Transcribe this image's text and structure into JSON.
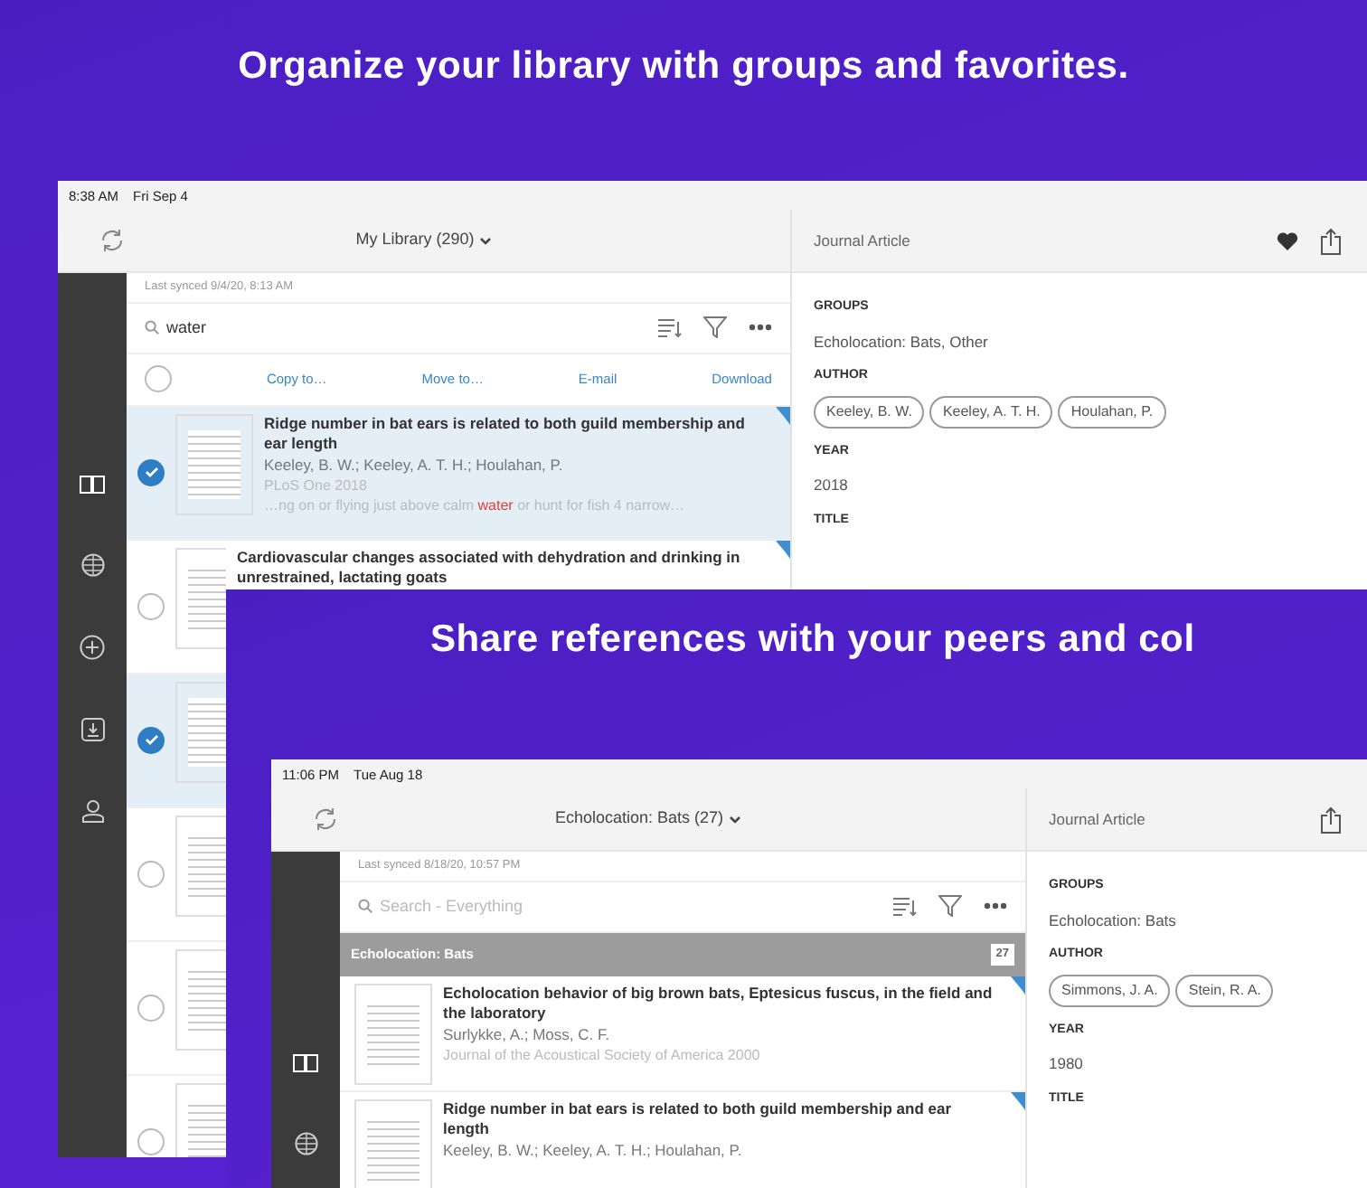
{
  "banner_title": "Organize your library with groups and favorites.",
  "screens": [
    {
      "status_time": "8:38 AM",
      "status_date": "Fri Sep 4",
      "library_title": "My Library (290)",
      "last_synced": "Last synced 9/4/20, 8:13 AM",
      "search": {
        "value": "water"
      },
      "selection_mode": true,
      "all_selected": false,
      "actions": [
        "Copy to…",
        "Move to…",
        "E-mail",
        "Download"
      ],
      "items": [
        {
          "selected": true,
          "title": "Ridge number in bat ears is related to both guild membership and ear length",
          "authors": "Keeley, B. W.; Keeley, A. T. H.; Houlahan, P.",
          "journal": "PLoS One 2018",
          "snippet": {
            "before": "…ng on or flying just above calm ",
            "highlight": "water",
            "after": " or hunt for fish 4 narrow…"
          }
        },
        {
          "selected": false,
          "title": "Cardiovascular changes associated with dehydration and drinking in unrestrained, lactating goats"
        },
        {
          "selected": true
        },
        {
          "selected": false
        },
        {
          "selected": false
        },
        {
          "selected": false
        }
      ],
      "detail": {
        "type": "Journal Article",
        "favorite": true,
        "fields": [
          {
            "label": "GROUPS",
            "kind": "text",
            "value": "Echolocation: Bats, Other"
          },
          {
            "label": "AUTHOR",
            "kind": "chips",
            "values": [
              "Keeley, B. W.",
              "Keeley, A. T. H.",
              "Houlahan, P."
            ]
          },
          {
            "label": "YEAR",
            "kind": "text",
            "value": "2018"
          },
          {
            "label": "TITLE",
            "kind": "text"
          }
        ]
      }
    },
    {
      "panel_heading": "Share references with your peers and col",
      "status_time": "11:06 PM",
      "status_date": "Tue Aug 18",
      "library_title": "Echolocation: Bats (27)",
      "last_synced": "Last synced 8/18/20, 10:57 PM",
      "search": {
        "placeholder": "Search - Everything"
      },
      "selection_mode": false,
      "group": {
        "label": "Echolocation: Bats",
        "count": "27"
      },
      "items": [
        {
          "title": "Echolocation behavior of big brown bats, Eptesicus fuscus, in the field and the laboratory",
          "authors": "Surlykke, A.; Moss, C. F.",
          "journal": "Journal of the Acoustical Society of America 2000"
        },
        {
          "title": "Ridge number in bat ears is related to both guild membership and ear length",
          "authors": "Keeley, B. W.; Keeley, A. T. H.; Houlahan, P."
        }
      ],
      "detail": {
        "type": "Journal Article",
        "fields": [
          {
            "label": "GROUPS",
            "kind": "text",
            "value": "Echolocation: Bats"
          },
          {
            "label": "AUTHOR",
            "kind": "chips",
            "values": [
              "Simmons, J. A.",
              "Stein, R. A."
            ]
          },
          {
            "label": "YEAR",
            "kind": "text",
            "value": "1980"
          },
          {
            "label": "TITLE",
            "kind": "text"
          }
        ]
      }
    }
  ]
}
